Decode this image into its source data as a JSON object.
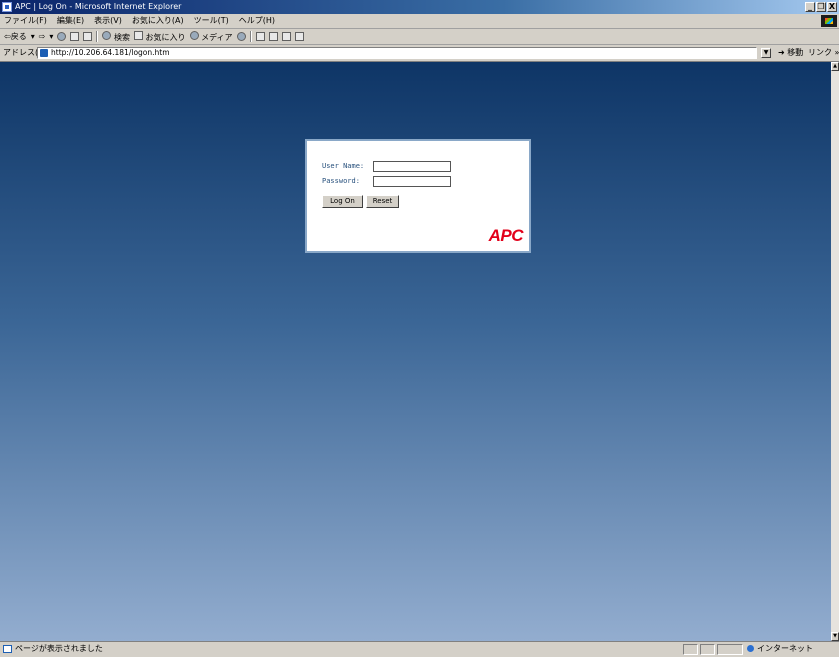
{
  "window": {
    "title": "APC | Log On - Microsoft Internet Explorer",
    "controls": [
      "_",
      "❐",
      "X"
    ]
  },
  "menu": [
    "ファイル(F)",
    "編集(E)",
    "表示(V)",
    "お気に入り(A)",
    "ツール(T)",
    "ヘルプ(H)"
  ],
  "toolbar": {
    "back": "⇦戻る",
    "search": "検索",
    "favorites": "お気に入り",
    "media": "メディア"
  },
  "address": {
    "label": "アドレス(D)",
    "url": "http://10.206.64.181/logon.htm",
    "go": "移動",
    "links": "リンク »"
  },
  "login": {
    "username_label": "User Name:",
    "password_label": "Password:",
    "username_value": "",
    "password_value": "",
    "logon_button": "Log On",
    "reset_button": "Reset",
    "logo": "APC"
  },
  "status": {
    "text": "ページが表示されました",
    "zone": "インターネット"
  },
  "colors": {
    "title_bar": "#0a246a",
    "background_top": "#0e3566",
    "background_bottom": "#93adcf",
    "logo_red": "#e2001a",
    "label_blue": "#27507c"
  }
}
